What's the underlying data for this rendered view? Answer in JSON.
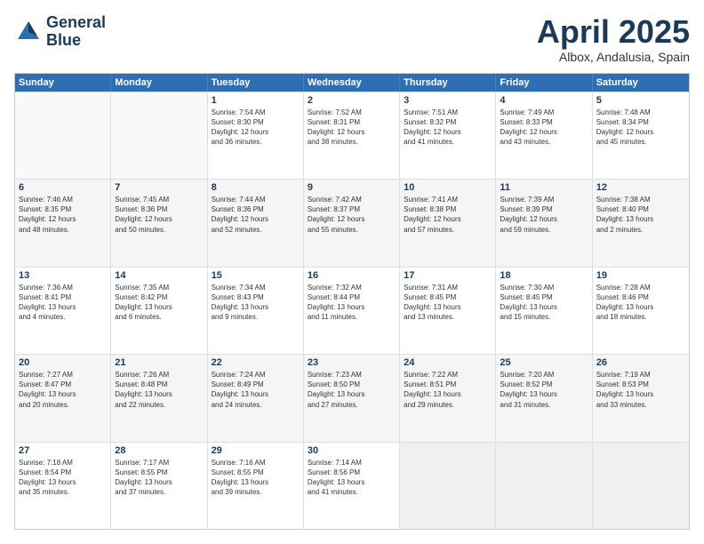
{
  "logo": {
    "line1": "General",
    "line2": "Blue"
  },
  "title": "April 2025",
  "subtitle": "Albox, Andalusia, Spain",
  "headers": [
    "Sunday",
    "Monday",
    "Tuesday",
    "Wednesday",
    "Thursday",
    "Friday",
    "Saturday"
  ],
  "weeks": [
    [
      {
        "day": "",
        "info": ""
      },
      {
        "day": "",
        "info": ""
      },
      {
        "day": "1",
        "info": "Sunrise: 7:54 AM\nSunset: 8:30 PM\nDaylight: 12 hours\nand 36 minutes."
      },
      {
        "day": "2",
        "info": "Sunrise: 7:52 AM\nSunset: 8:31 PM\nDaylight: 12 hours\nand 38 minutes."
      },
      {
        "day": "3",
        "info": "Sunrise: 7:51 AM\nSunset: 8:32 PM\nDaylight: 12 hours\nand 41 minutes."
      },
      {
        "day": "4",
        "info": "Sunrise: 7:49 AM\nSunset: 8:33 PM\nDaylight: 12 hours\nand 43 minutes."
      },
      {
        "day": "5",
        "info": "Sunrise: 7:48 AM\nSunset: 8:34 PM\nDaylight: 12 hours\nand 45 minutes."
      }
    ],
    [
      {
        "day": "6",
        "info": "Sunrise: 7:46 AM\nSunset: 8:35 PM\nDaylight: 12 hours\nand 48 minutes."
      },
      {
        "day": "7",
        "info": "Sunrise: 7:45 AM\nSunset: 8:36 PM\nDaylight: 12 hours\nand 50 minutes."
      },
      {
        "day": "8",
        "info": "Sunrise: 7:44 AM\nSunset: 8:36 PM\nDaylight: 12 hours\nand 52 minutes."
      },
      {
        "day": "9",
        "info": "Sunrise: 7:42 AM\nSunset: 8:37 PM\nDaylight: 12 hours\nand 55 minutes."
      },
      {
        "day": "10",
        "info": "Sunrise: 7:41 AM\nSunset: 8:38 PM\nDaylight: 12 hours\nand 57 minutes."
      },
      {
        "day": "11",
        "info": "Sunrise: 7:39 AM\nSunset: 8:39 PM\nDaylight: 12 hours\nand 59 minutes."
      },
      {
        "day": "12",
        "info": "Sunrise: 7:38 AM\nSunset: 8:40 PM\nDaylight: 13 hours\nand 2 minutes."
      }
    ],
    [
      {
        "day": "13",
        "info": "Sunrise: 7:36 AM\nSunset: 8:41 PM\nDaylight: 13 hours\nand 4 minutes."
      },
      {
        "day": "14",
        "info": "Sunrise: 7:35 AM\nSunset: 8:42 PM\nDaylight: 13 hours\nand 6 minutes."
      },
      {
        "day": "15",
        "info": "Sunrise: 7:34 AM\nSunset: 8:43 PM\nDaylight: 13 hours\nand 9 minutes."
      },
      {
        "day": "16",
        "info": "Sunrise: 7:32 AM\nSunset: 8:44 PM\nDaylight: 13 hours\nand 11 minutes."
      },
      {
        "day": "17",
        "info": "Sunrise: 7:31 AM\nSunset: 8:45 PM\nDaylight: 13 hours\nand 13 minutes."
      },
      {
        "day": "18",
        "info": "Sunrise: 7:30 AM\nSunset: 8:45 PM\nDaylight: 13 hours\nand 15 minutes."
      },
      {
        "day": "19",
        "info": "Sunrise: 7:28 AM\nSunset: 8:46 PM\nDaylight: 13 hours\nand 18 minutes."
      }
    ],
    [
      {
        "day": "20",
        "info": "Sunrise: 7:27 AM\nSunset: 8:47 PM\nDaylight: 13 hours\nand 20 minutes."
      },
      {
        "day": "21",
        "info": "Sunrise: 7:26 AM\nSunset: 8:48 PM\nDaylight: 13 hours\nand 22 minutes."
      },
      {
        "day": "22",
        "info": "Sunrise: 7:24 AM\nSunset: 8:49 PM\nDaylight: 13 hours\nand 24 minutes."
      },
      {
        "day": "23",
        "info": "Sunrise: 7:23 AM\nSunset: 8:50 PM\nDaylight: 13 hours\nand 27 minutes."
      },
      {
        "day": "24",
        "info": "Sunrise: 7:22 AM\nSunset: 8:51 PM\nDaylight: 13 hours\nand 29 minutes."
      },
      {
        "day": "25",
        "info": "Sunrise: 7:20 AM\nSunset: 8:52 PM\nDaylight: 13 hours\nand 31 minutes."
      },
      {
        "day": "26",
        "info": "Sunrise: 7:19 AM\nSunset: 8:53 PM\nDaylight: 13 hours\nand 33 minutes."
      }
    ],
    [
      {
        "day": "27",
        "info": "Sunrise: 7:18 AM\nSunset: 8:54 PM\nDaylight: 13 hours\nand 35 minutes."
      },
      {
        "day": "28",
        "info": "Sunrise: 7:17 AM\nSunset: 8:55 PM\nDaylight: 13 hours\nand 37 minutes."
      },
      {
        "day": "29",
        "info": "Sunrise: 7:16 AM\nSunset: 8:55 PM\nDaylight: 13 hours\nand 39 minutes."
      },
      {
        "day": "30",
        "info": "Sunrise: 7:14 AM\nSunset: 8:56 PM\nDaylight: 13 hours\nand 41 minutes."
      },
      {
        "day": "",
        "info": ""
      },
      {
        "day": "",
        "info": ""
      },
      {
        "day": "",
        "info": ""
      }
    ]
  ]
}
